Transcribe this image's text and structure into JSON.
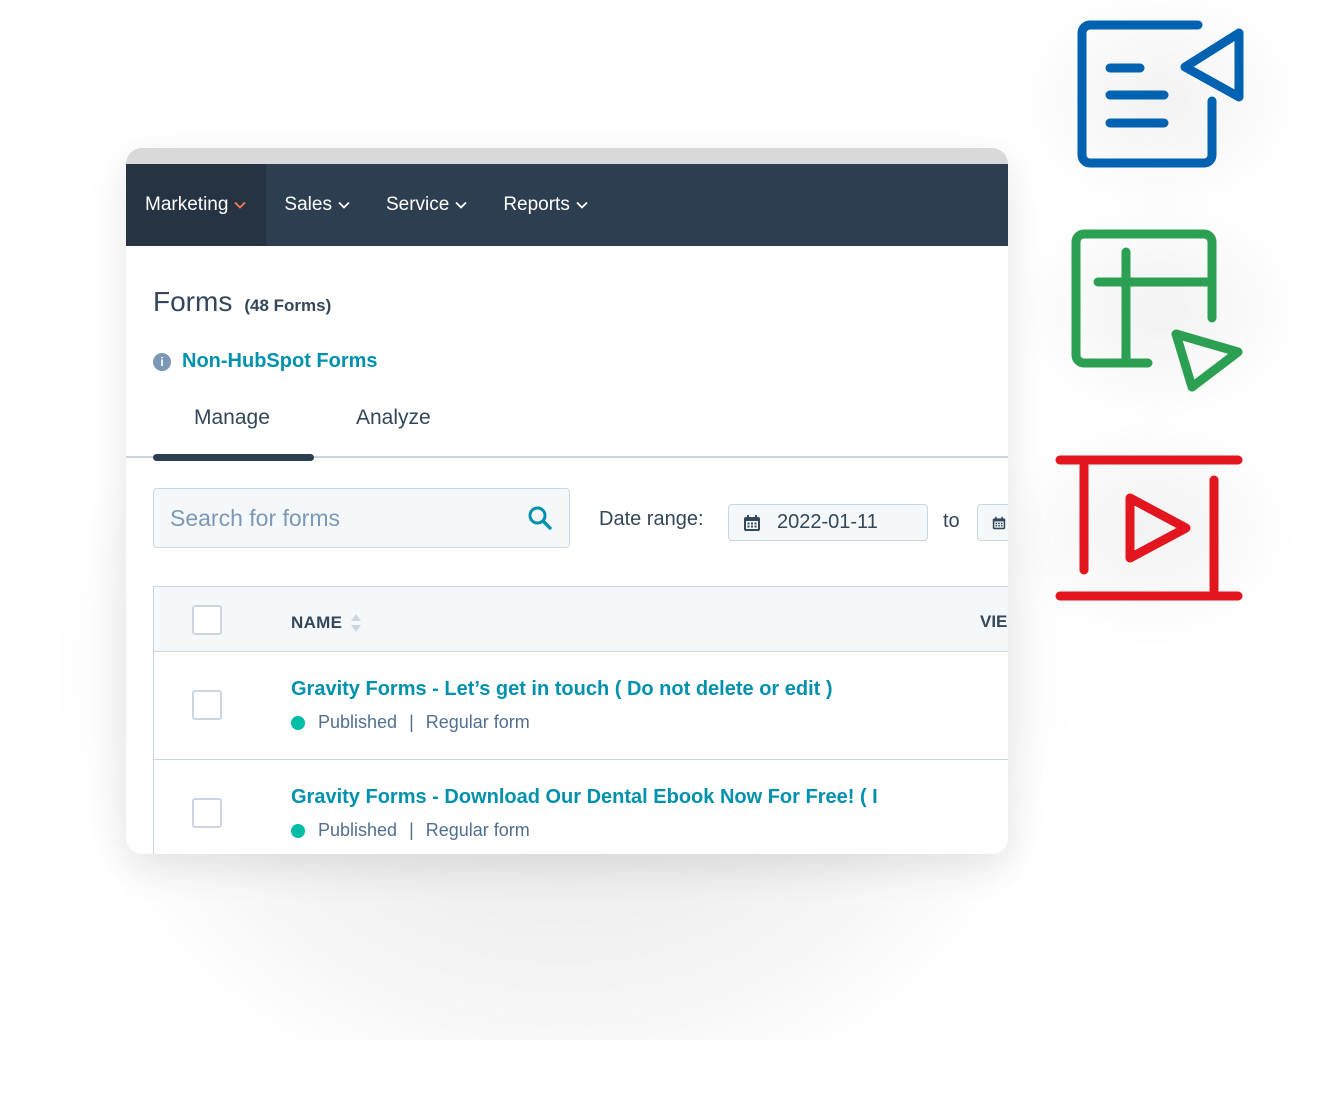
{
  "nav": {
    "items": [
      {
        "label": "Marketing",
        "active": true
      },
      {
        "label": "Sales",
        "active": false
      },
      {
        "label": "Service",
        "active": false
      },
      {
        "label": "Reports",
        "active": false
      }
    ]
  },
  "page": {
    "title": "Forms",
    "count": "(48 Forms)",
    "info_link": "Non-HubSpot Forms"
  },
  "tabs": [
    {
      "label": "Manage",
      "active": true
    },
    {
      "label": "Analyze",
      "active": false
    }
  ],
  "search": {
    "placeholder": "Search for forms",
    "value": ""
  },
  "date_range": {
    "label": "Date range:",
    "start": "2022-01-11",
    "separator": "to",
    "end": ""
  },
  "table": {
    "columns": [
      "NAME",
      "VIE"
    ],
    "rows": [
      {
        "title": "Gravity Forms - Let’s get in touch ( Do not delete or edit )",
        "status": "Published",
        "type": "Regular form"
      },
      {
        "title": "Gravity Forms - Download Our Dental Ebook Now For Free! ( I",
        "status": "Published",
        "type": "Regular form"
      }
    ]
  },
  "colors": {
    "nav_bg": "#2d3e50",
    "nav_active_bg": "#253342",
    "link": "#0091ae",
    "published": "#00bda5",
    "marketing_chevron": "#ff7a59",
    "icon_blue": "#0062b1",
    "icon_green": "#2ca052",
    "icon_red": "#e3151e"
  },
  "decorative_icons": [
    "email-form-icon",
    "table-form-icon",
    "video-form-icon"
  ]
}
